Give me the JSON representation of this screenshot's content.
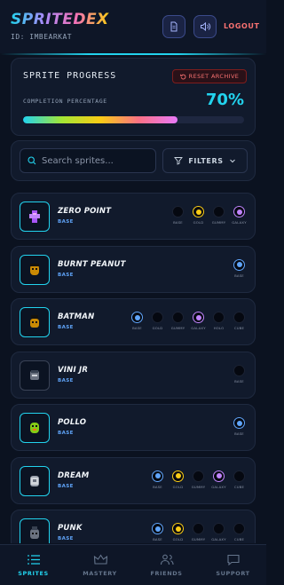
{
  "header": {
    "logo": "SPRITEDEX",
    "user_id": "ID: IMBEARKAT",
    "logout_label": "LOGOUT"
  },
  "progress": {
    "title": "SPRITE PROGRESS",
    "reset_label": "RESET ARCHIVE",
    "completion_label": "COMPLETION PERCENTAGE",
    "completion_value": "70%",
    "completion_fraction": 0.7
  },
  "search": {
    "placeholder": "Search sprites...",
    "filters_label": "FILTERS"
  },
  "colors": {
    "accent": "#22d3ee",
    "base": "#60a5fa",
    "gold": "#facc15",
    "galaxy": "#c084fc",
    "logout": "#f87171"
  },
  "sprites": [
    {
      "name": "ZERO POINT",
      "tier": "BASE",
      "avatar_icon": "zero-point-sprite-icon",
      "variants": [
        {
          "label": "BASE",
          "owned": false,
          "type": "base"
        },
        {
          "label": "GOLD",
          "owned": true,
          "type": "gold"
        },
        {
          "label": "GUMMY",
          "owned": false,
          "type": "gummy"
        },
        {
          "label": "GALAXY",
          "owned": true,
          "type": "galaxy"
        }
      ]
    },
    {
      "name": "BURNT PEANUT",
      "tier": "BASE",
      "avatar_icon": "burnt-peanut-sprite-icon",
      "variants": [
        {
          "label": "BASE",
          "owned": true,
          "type": "base"
        }
      ]
    },
    {
      "name": "BATMAN",
      "tier": "BASE",
      "avatar_icon": "batman-sprite-icon",
      "variants": [
        {
          "label": "BASE",
          "owned": true,
          "type": "base"
        },
        {
          "label": "GOLD",
          "owned": false,
          "type": "gold"
        },
        {
          "label": "GUMMY",
          "owned": false,
          "type": "gummy"
        },
        {
          "label": "GALAXY",
          "owned": true,
          "type": "galaxy"
        },
        {
          "label": "HOLO",
          "owned": false,
          "type": "holo"
        },
        {
          "label": "CUBE",
          "owned": false,
          "type": "cube"
        }
      ]
    },
    {
      "name": "VINI JR",
      "tier": "BASE",
      "avatar_icon": "vini-jr-sprite-icon",
      "variants": [
        {
          "label": "BASE",
          "owned": false,
          "type": "base"
        }
      ]
    },
    {
      "name": "POLLO",
      "tier": "BASE",
      "avatar_icon": "pollo-sprite-icon",
      "variants": [
        {
          "label": "BASE",
          "owned": true,
          "type": "base"
        }
      ]
    },
    {
      "name": "DREAM",
      "tier": "BASE",
      "avatar_icon": "dream-sprite-icon",
      "variants": [
        {
          "label": "BASE",
          "owned": true,
          "type": "base"
        },
        {
          "label": "GOLD",
          "owned": true,
          "type": "gold"
        },
        {
          "label": "GUMMY",
          "owned": false,
          "type": "gummy"
        },
        {
          "label": "GALAXY",
          "owned": true,
          "type": "galaxy"
        },
        {
          "label": "CUBE",
          "owned": false,
          "type": "cube"
        }
      ]
    },
    {
      "name": "PUNK",
      "tier": "BASE",
      "avatar_icon": "punk-sprite-icon",
      "variants": [
        {
          "label": "BASE",
          "owned": true,
          "type": "base"
        },
        {
          "label": "GOLD",
          "owned": true,
          "type": "gold"
        },
        {
          "label": "GUMMY",
          "owned": false,
          "type": "gummy"
        },
        {
          "label": "GALAXY",
          "owned": false,
          "type": "galaxy"
        },
        {
          "label": "CUBE",
          "owned": false,
          "type": "cube"
        }
      ]
    }
  ],
  "nav": [
    {
      "label": "SPRITES",
      "icon": "list-icon",
      "active": true
    },
    {
      "label": "MASTERY",
      "icon": "crown-icon",
      "active": false
    },
    {
      "label": "FRIENDS",
      "icon": "users-icon",
      "active": false
    },
    {
      "label": "SUPPORT",
      "icon": "chat-icon",
      "active": false
    }
  ]
}
